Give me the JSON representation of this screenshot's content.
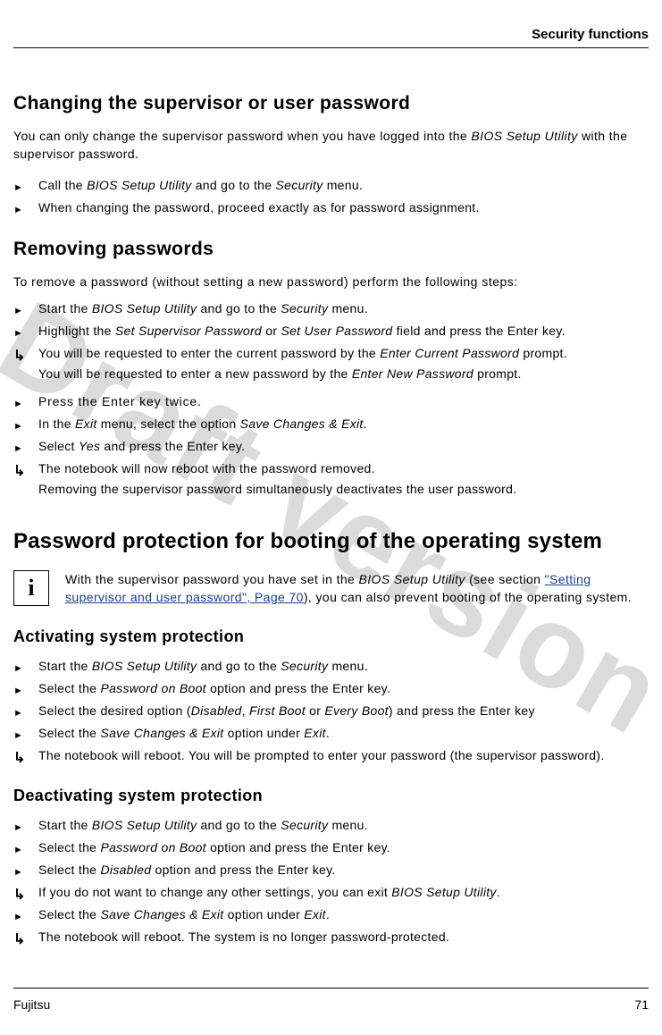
{
  "header": {
    "running_title": "Security functions"
  },
  "watermark": "Draft version",
  "sections": {
    "changing": {
      "title": "Changing the supervisor or user password",
      "intro_pre": "You can only change the supervisor password when you have logged into the ",
      "intro_it": "BIOS Setup Utility",
      "intro_post": " with the supervisor password.",
      "step1_pre": "Call the ",
      "step1_it1": "BIOS Setup Utility",
      "step1_mid": " and go to the ",
      "step1_it2": "Security",
      "step1_post": " menu.",
      "step2": "When changing the password, proceed exactly as for password assignment."
    },
    "removing": {
      "title": "Removing passwords",
      "intro": "To remove a password (without setting a new password) perform the following steps:",
      "s1_pre": "Start the ",
      "s1_it1": "BIOS Setup Utility",
      "s1_mid": " and go to the ",
      "s1_it2": "Security",
      "s1_post": " menu.",
      "s2_pre": "Highlight the ",
      "s2_it1": "Set Supervisor Password",
      "s2_mid": " or ",
      "s2_it2": "Set User Password",
      "s2_post": " field and press the Enter key.",
      "r1_pre": "You will be requested to enter the current password by the ",
      "r1_it": "Enter Current Password",
      "r1_post": " prompt.",
      "r1b_pre": "You will be requested to enter a new password by the ",
      "r1b_it": "Enter New Password",
      "r1b_post": " prompt.",
      "s3": "Press the Enter key twice.",
      "s4_pre": "In the ",
      "s4_it1": "Exit",
      "s4_mid": " menu, select the option ",
      "s4_it2": "Save Changes & Exit",
      "s4_post": ".",
      "s5_pre": "Select ",
      "s5_it": "Yes",
      "s5_post": " and press the Enter key.",
      "r2a": "The notebook will now reboot with the password removed.",
      "r2b": "Removing the supervisor password simultaneously deactivates the user password."
    },
    "boot": {
      "title": "Password protection for booting of the operating system",
      "info_pre": "With the supervisor password you have set in the ",
      "info_it": "BIOS Setup Utility",
      "info_mid": " (see section ",
      "info_link": "\"Setting supervisor and user password\", Page 70",
      "info_post": "), you can also prevent booting of the operating system."
    },
    "activating": {
      "title": "Activating system protection",
      "s1_pre": "Start the ",
      "s1_it1": "BIOS Setup Utility",
      "s1_mid": " and go to the ",
      "s1_it2": "Security",
      "s1_post": " menu.",
      "s2_pre": "Select the ",
      "s2_it": "Password on Boot",
      "s2_post": " option and press the Enter key.",
      "s3_pre": "Select the desired option (",
      "s3_it1": "Disabled",
      "s3_mid1": ", ",
      "s3_it2": "First Boot",
      "s3_mid2": " or ",
      "s3_it3": "Every Boot",
      "s3_post": ") and press the Enter key",
      "s4_pre": "Select the ",
      "s4_it1": "Save Changes & Exit",
      "s4_mid": " option under ",
      "s4_it2": "Exit",
      "s4_post": ".",
      "r1": "The notebook will reboot. You will be prompted to enter your password (the supervisor password)."
    },
    "deactivating": {
      "title": "Deactivating system protection",
      "s1_pre": "Start the ",
      "s1_it1": "BIOS Setup Utility",
      "s1_mid": " and go to the ",
      "s1_it2": "Security",
      "s1_post": " menu.",
      "s2_pre": "Select the ",
      "s2_it": "Password on Boot",
      "s2_post": " option and press the Enter key.",
      "s3_pre": "Select the ",
      "s3_it": "Disabled",
      "s3_post": " option and press the Enter key.",
      "r1_pre": "If you do not want to change any other settings, you can exit ",
      "r1_it": "BIOS Setup Utility",
      "r1_post": ".",
      "s4_pre": "Select the ",
      "s4_it1": "Save Changes & Exit",
      "s4_mid": " option under ",
      "s4_it2": "Exit",
      "s4_post": ".",
      "r2": "The notebook will reboot. The system is no longer password-protected."
    }
  },
  "footer": {
    "brand": "Fujitsu",
    "page_no": "71"
  },
  "info_icon_letter": "i"
}
